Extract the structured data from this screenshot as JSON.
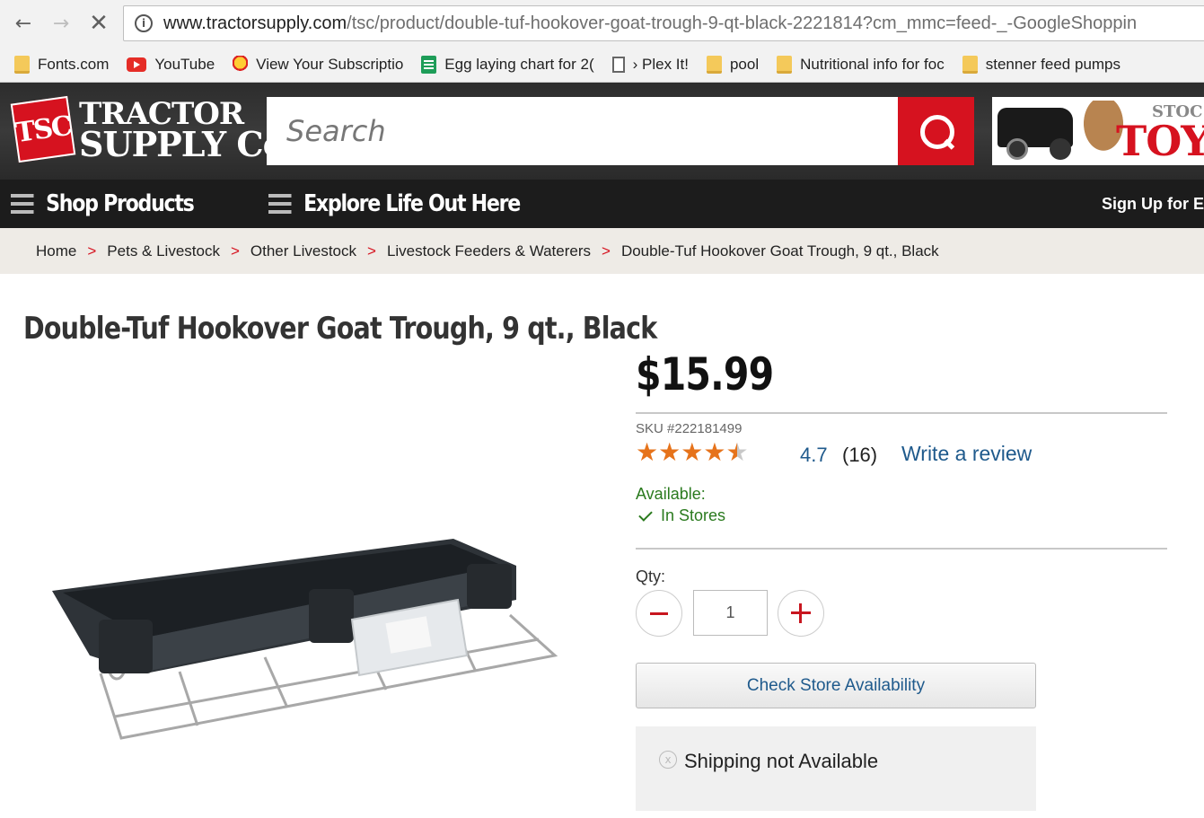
{
  "browser": {
    "url_host": "www.tractorsupply.com",
    "url_path": "/tsc/product/double-tuf-hookover-goat-trough-9-qt-black-2221814?cm_mmc=feed-_-GoogleShoppin",
    "bookmarks": [
      {
        "label": "Fonts.com",
        "icon": "folder-icon"
      },
      {
        "label": "YouTube",
        "icon": "youtube-icon"
      },
      {
        "label": "View Your Subscriptio",
        "icon": "chick-icon"
      },
      {
        "label": "Egg laying chart for 2(",
        "icon": "sheets-icon"
      },
      {
        "label": "› Plex It!",
        "icon": "page-icon"
      },
      {
        "label": "pool",
        "icon": "folder-icon"
      },
      {
        "label": "Nutritional info for foc",
        "icon": "folder-icon"
      },
      {
        "label": "stenner feed pumps",
        "icon": "folder-icon"
      }
    ]
  },
  "header": {
    "logo_badge": "TSC",
    "logo_line1": "TRACTOR",
    "logo_line2": "SUPPLY Co",
    "search_placeholder": "Search",
    "promo_small": "STOC",
    "promo_big": "TOY",
    "menu": {
      "shop": "Shop Products",
      "explore": "Explore Life Out Here",
      "signup": "Sign Up for E"
    }
  },
  "breadcrumb": [
    "Home",
    "Pets & Livestock",
    "Other Livestock",
    "Livestock Feeders & Waterers",
    "Double-Tuf Hookover Goat Trough, 9 qt., Black"
  ],
  "breadcrumb_sep": ">",
  "product": {
    "title": "Double-Tuf Hookover Goat Trough, 9 qt., Black",
    "price": "$15.99",
    "sku": "SKU #222181499",
    "rating_value": 4.7,
    "rating_text": "4.7",
    "review_count": "(16)",
    "write_review": "Write a review",
    "available_label": "Available:",
    "available_value": "In Stores",
    "qty_label": "Qty:",
    "qty_value": "1",
    "check_store": "Check Store Availability",
    "shipping": "Shipping not Available"
  },
  "colors": {
    "brand_red": "#d6121f",
    "star_orange": "#e6731b",
    "link_blue": "#1f5a8c",
    "available_green": "#2a7a1e"
  }
}
